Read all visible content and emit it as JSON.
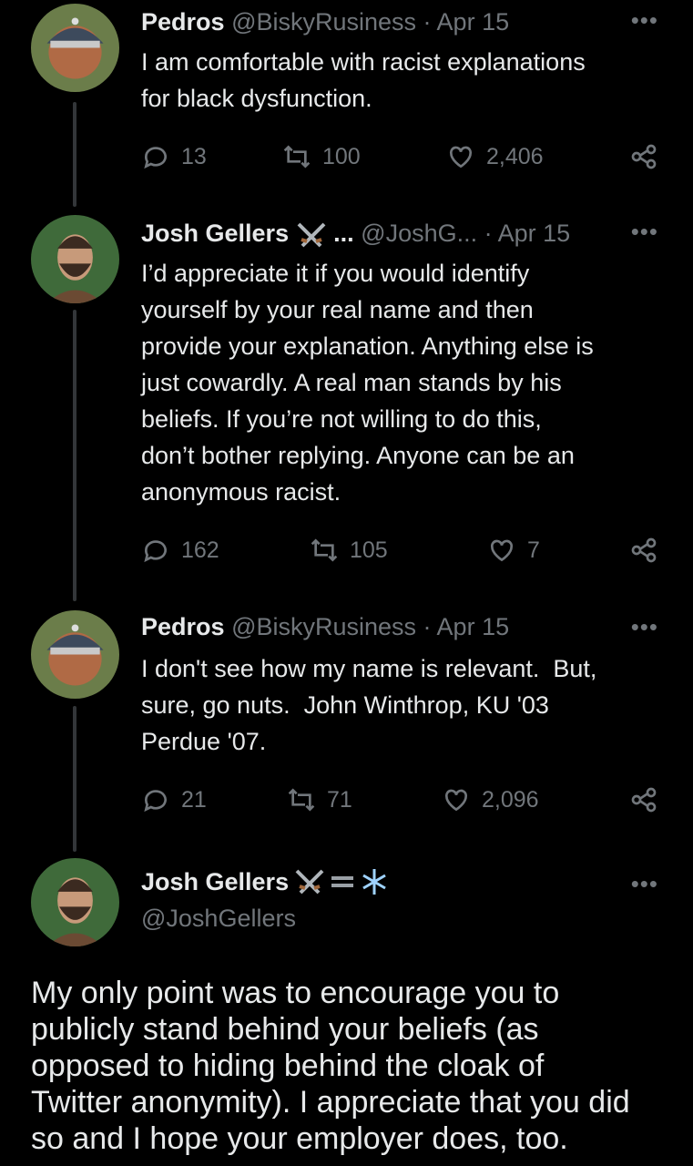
{
  "tweets": [
    {
      "name": "Pedros",
      "handle": "@BiskyRusiness",
      "date": "· Apr 15",
      "text": "I am comfortable with racist explanations\nfor black dysfunction.",
      "replies": "13",
      "retweets": "100",
      "likes": "2,406"
    },
    {
      "name": "Josh Gellers",
      "name_suffix": "...",
      "handle": "@JoshG...",
      "date": "· Apr 15",
      "text": "I’d appreciate it if you would identify\nyourself by your real name and then\nprovide your explanation. Anything else is\njust cowardly. A real man stands by his\nbeliefs. If you’re not willing to do this,\ndon’t bother replying. Anyone can be an\nanonymous racist.",
      "replies": "162",
      "retweets": "105",
      "likes": "7"
    },
    {
      "name": "Pedros",
      "handle": "@BiskyRusiness",
      "date": "· Apr 15",
      "text": "I don't see how my name is relevant.  But,\nsure, go nuts.  John Winthrop, KU '03\nPerdue '07.",
      "replies": "21",
      "retweets": "71",
      "likes": "2,096"
    }
  ],
  "main_tweet": {
    "name": "Josh Gellers",
    "handle": "@JoshGellers",
    "text": "My only point was to encourage you to\npublicly stand behind your beliefs (as\nopposed to hiding behind the cloak of\nTwitter anonymity). I appreciate that you did\nso and I hope your employer does, too."
  },
  "more_label": "•••",
  "icons": [
    "reply-icon",
    "retweet-icon",
    "like-icon",
    "share-icon",
    "more-icon",
    "swords-icon",
    "snowflake-icon"
  ],
  "colors": {
    "background": "#000000",
    "text": "#e7e9ea",
    "secondary": "#71767b",
    "thread_line": "#333639"
  }
}
